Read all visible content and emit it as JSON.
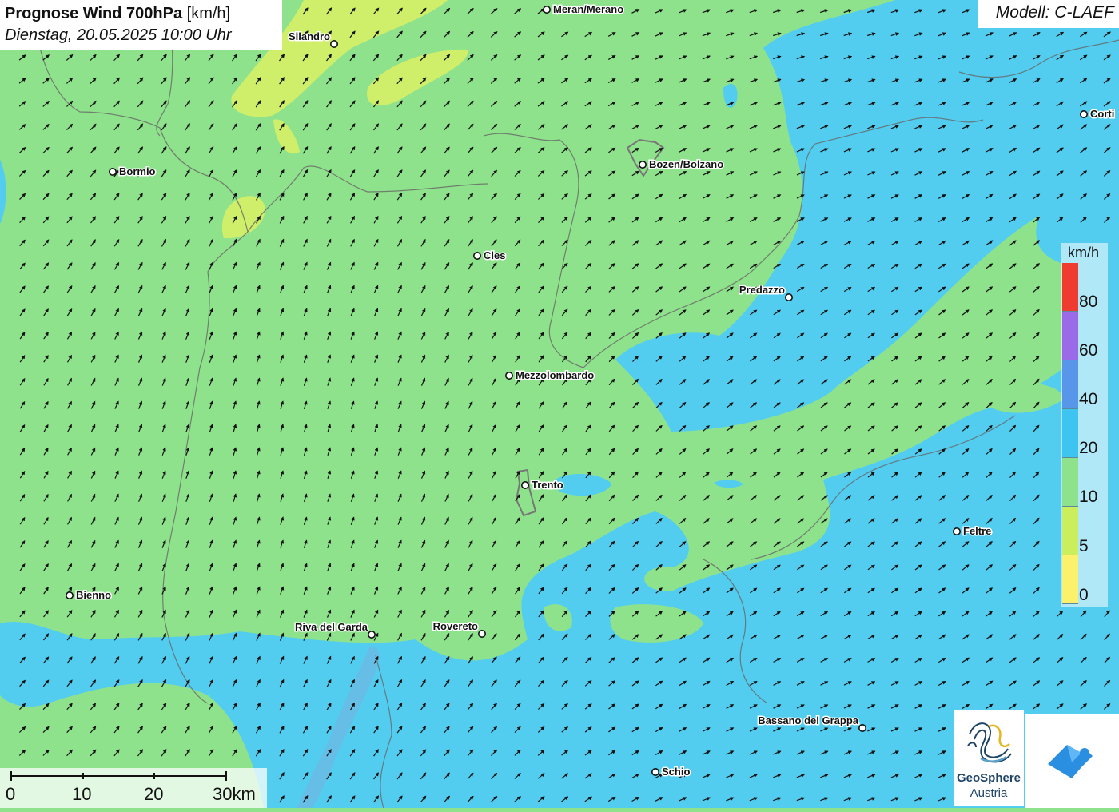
{
  "header": {
    "title_bold": "Prognose Wind 700hPa",
    "title_unit": "[km/h]",
    "datetime": "Dienstag, 20.05.2025 10:00 Uhr"
  },
  "model": {
    "label": "Modell: C-LAEF"
  },
  "map": {
    "wind_direction": "south-west to north-east",
    "cities": [
      {
        "name": "Meran/Merano",
        "side": "right"
      },
      {
        "name": "Silandro",
        "side": "left"
      },
      {
        "name": "Bormio",
        "side": "right"
      },
      {
        "name": "Bozen/Bolzano",
        "side": "right"
      },
      {
        "name": "Corti",
        "side": "right"
      },
      {
        "name": "Cles",
        "side": "right"
      },
      {
        "name": "Predazzo",
        "side": "left"
      },
      {
        "name": "Mezzolombardo",
        "side": "right"
      },
      {
        "name": "Trento",
        "side": "right"
      },
      {
        "name": "Feltre",
        "side": "right"
      },
      {
        "name": "Bienno",
        "side": "right"
      },
      {
        "name": "Riva del Garda",
        "side": "left"
      },
      {
        "name": "Rovereto",
        "side": "left"
      },
      {
        "name": "Bassano del Grappa",
        "side": "left"
      },
      {
        "name": "Schio",
        "side": "right"
      }
    ]
  },
  "legend": {
    "unit": "km/h",
    "colors": [
      "#f03b31",
      "#9b6ae8",
      "#5796e8",
      "#3ec4f0",
      "#8fe28c",
      "#cbee5c",
      "#fbf16a"
    ],
    "labels": [
      "80",
      "60",
      "40",
      "20",
      "10",
      "5",
      "0"
    ]
  },
  "scalebar": {
    "labels": [
      "0",
      "10",
      "20",
      "30km"
    ]
  },
  "logos": {
    "geosphere_line1": "GeoSphere",
    "geosphere_line2": "Austria"
  },
  "colors": {
    "green_10": "#8fe28c",
    "cyan_20": "#52cdf0",
    "yellow_5": "#cfee6a"
  }
}
